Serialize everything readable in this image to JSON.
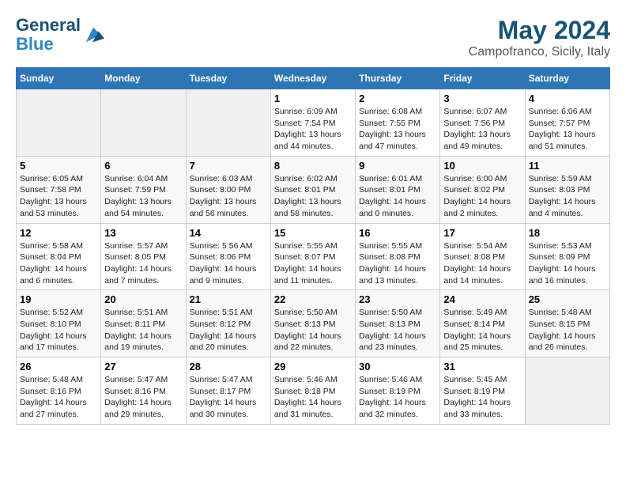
{
  "logo": {
    "line1": "General",
    "line2": "Blue"
  },
  "title": "May 2024",
  "subtitle": "Campofranco, Sicily, Italy",
  "weekdays": [
    "Sunday",
    "Monday",
    "Tuesday",
    "Wednesday",
    "Thursday",
    "Friday",
    "Saturday"
  ],
  "weeks": [
    [
      {
        "day": "",
        "info": ""
      },
      {
        "day": "",
        "info": ""
      },
      {
        "day": "",
        "info": ""
      },
      {
        "day": "1",
        "info": "Sunrise: 6:09 AM\nSunset: 7:54 PM\nDaylight: 13 hours\nand 44 minutes."
      },
      {
        "day": "2",
        "info": "Sunrise: 6:08 AM\nSunset: 7:55 PM\nDaylight: 13 hours\nand 47 minutes."
      },
      {
        "day": "3",
        "info": "Sunrise: 6:07 AM\nSunset: 7:56 PM\nDaylight: 13 hours\nand 49 minutes."
      },
      {
        "day": "4",
        "info": "Sunrise: 6:06 AM\nSunset: 7:57 PM\nDaylight: 13 hours\nand 51 minutes."
      }
    ],
    [
      {
        "day": "5",
        "info": "Sunrise: 6:05 AM\nSunset: 7:58 PM\nDaylight: 13 hours\nand 53 minutes."
      },
      {
        "day": "6",
        "info": "Sunrise: 6:04 AM\nSunset: 7:59 PM\nDaylight: 13 hours\nand 54 minutes."
      },
      {
        "day": "7",
        "info": "Sunrise: 6:03 AM\nSunset: 8:00 PM\nDaylight: 13 hours\nand 56 minutes."
      },
      {
        "day": "8",
        "info": "Sunrise: 6:02 AM\nSunset: 8:01 PM\nDaylight: 13 hours\nand 58 minutes."
      },
      {
        "day": "9",
        "info": "Sunrise: 6:01 AM\nSunset: 8:01 PM\nDaylight: 14 hours\nand 0 minutes."
      },
      {
        "day": "10",
        "info": "Sunrise: 6:00 AM\nSunset: 8:02 PM\nDaylight: 14 hours\nand 2 minutes."
      },
      {
        "day": "11",
        "info": "Sunrise: 5:59 AM\nSunset: 8:03 PM\nDaylight: 14 hours\nand 4 minutes."
      }
    ],
    [
      {
        "day": "12",
        "info": "Sunrise: 5:58 AM\nSunset: 8:04 PM\nDaylight: 14 hours\nand 6 minutes."
      },
      {
        "day": "13",
        "info": "Sunrise: 5:57 AM\nSunset: 8:05 PM\nDaylight: 14 hours\nand 7 minutes."
      },
      {
        "day": "14",
        "info": "Sunrise: 5:56 AM\nSunset: 8:06 PM\nDaylight: 14 hours\nand 9 minutes."
      },
      {
        "day": "15",
        "info": "Sunrise: 5:55 AM\nSunset: 8:07 PM\nDaylight: 14 hours\nand 11 minutes."
      },
      {
        "day": "16",
        "info": "Sunrise: 5:55 AM\nSunset: 8:08 PM\nDaylight: 14 hours\nand 13 minutes."
      },
      {
        "day": "17",
        "info": "Sunrise: 5:54 AM\nSunset: 8:08 PM\nDaylight: 14 hours\nand 14 minutes."
      },
      {
        "day": "18",
        "info": "Sunrise: 5:53 AM\nSunset: 8:09 PM\nDaylight: 14 hours\nand 16 minutes."
      }
    ],
    [
      {
        "day": "19",
        "info": "Sunrise: 5:52 AM\nSunset: 8:10 PM\nDaylight: 14 hours\nand 17 minutes."
      },
      {
        "day": "20",
        "info": "Sunrise: 5:51 AM\nSunset: 8:11 PM\nDaylight: 14 hours\nand 19 minutes."
      },
      {
        "day": "21",
        "info": "Sunrise: 5:51 AM\nSunset: 8:12 PM\nDaylight: 14 hours\nand 20 minutes."
      },
      {
        "day": "22",
        "info": "Sunrise: 5:50 AM\nSunset: 8:13 PM\nDaylight: 14 hours\nand 22 minutes."
      },
      {
        "day": "23",
        "info": "Sunrise: 5:50 AM\nSunset: 8:13 PM\nDaylight: 14 hours\nand 23 minutes."
      },
      {
        "day": "24",
        "info": "Sunrise: 5:49 AM\nSunset: 8:14 PM\nDaylight: 14 hours\nand 25 minutes."
      },
      {
        "day": "25",
        "info": "Sunrise: 5:48 AM\nSunset: 8:15 PM\nDaylight: 14 hours\nand 26 minutes."
      }
    ],
    [
      {
        "day": "26",
        "info": "Sunrise: 5:48 AM\nSunset: 8:16 PM\nDaylight: 14 hours\nand 27 minutes."
      },
      {
        "day": "27",
        "info": "Sunrise: 5:47 AM\nSunset: 8:16 PM\nDaylight: 14 hours\nand 29 minutes."
      },
      {
        "day": "28",
        "info": "Sunrise: 5:47 AM\nSunset: 8:17 PM\nDaylight: 14 hours\nand 30 minutes."
      },
      {
        "day": "29",
        "info": "Sunrise: 5:46 AM\nSunset: 8:18 PM\nDaylight: 14 hours\nand 31 minutes."
      },
      {
        "day": "30",
        "info": "Sunrise: 5:46 AM\nSunset: 8:19 PM\nDaylight: 14 hours\nand 32 minutes."
      },
      {
        "day": "31",
        "info": "Sunrise: 5:45 AM\nSunset: 8:19 PM\nDaylight: 14 hours\nand 33 minutes."
      },
      {
        "day": "",
        "info": ""
      }
    ]
  ]
}
